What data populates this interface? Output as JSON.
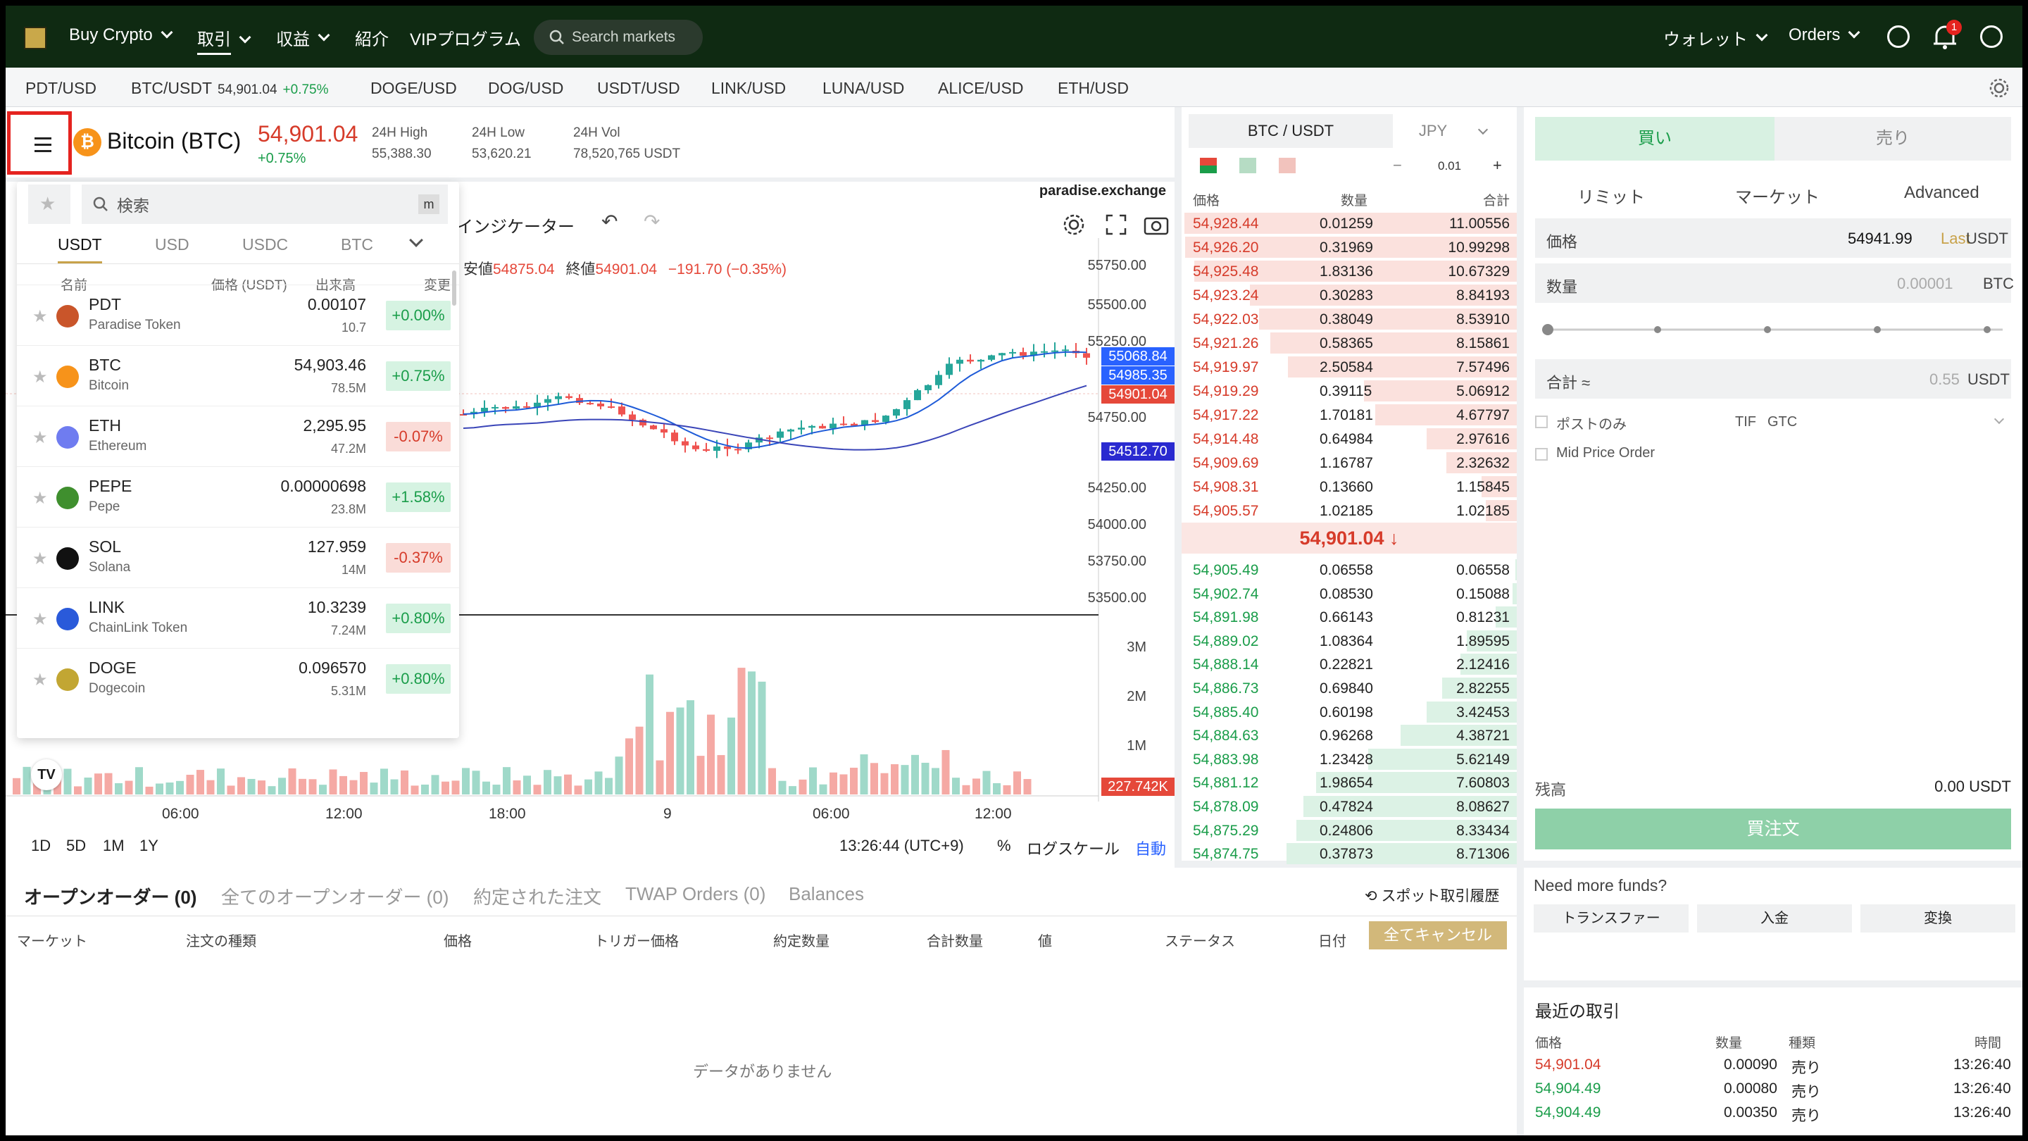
{
  "nav": {
    "items": [
      "Buy Crypto",
      "取引",
      "収益",
      "紹介",
      "VIPプログラム"
    ],
    "search_placeholder": "Search markets",
    "wallet": "ウォレット",
    "orders": "Orders",
    "notif_count": "1"
  },
  "tickers": [
    {
      "label": "PDT/USD"
    },
    {
      "label": "BTC/USDT",
      "price": "54,901.04",
      "change": "+0.75%"
    },
    {
      "label": "DOGE/USD"
    },
    {
      "label": "DOG/USD"
    },
    {
      "label": "USDT/USD"
    },
    {
      "label": "LINK/USD"
    },
    {
      "label": "LUNA/USD"
    },
    {
      "label": "ALICE/USD"
    },
    {
      "label": "ETH/USD"
    }
  ],
  "header": {
    "pair": "Bitcoin (BTC)",
    "price": "54,901.04",
    "change": "+0.75%",
    "high_label": "24H High",
    "high": "55,388.30",
    "low_label": "24H Low",
    "low": "53,620.21",
    "vol_label": "24H Vol",
    "vol": "78,520,765 USDT"
  },
  "chart": {
    "watermark": "paradise.exchange",
    "indicators": "インジケーター",
    "ohlc_low_label": "安値",
    "ohlc_low": "54875.04",
    "ohlc_close_label": "終値",
    "ohlc_close": "54901.04",
    "ohlc_change": "−191.70 (−0.35%)",
    "price_axis": [
      "55750.00",
      "55500.00",
      "55250.00",
      "54750.00",
      "54250.00",
      "54000.00",
      "53750.00",
      "53500.00"
    ],
    "price_tags": [
      {
        "value": "55068.84",
        "color": "#2962ff"
      },
      {
        "value": "54985.35",
        "color": "#2962ff"
      },
      {
        "value": "54901.04",
        "color": "#e5483a"
      },
      {
        "value": "54512.70",
        "color": "#2a2ad0"
      }
    ],
    "volume_axis": [
      "3M",
      "2M",
      "1M"
    ],
    "volume_tag": "227.742K",
    "time_axis": [
      "06:00",
      "12:00",
      "18:00",
      "9",
      "06:00",
      "12:00"
    ],
    "intervals": [
      "1D",
      "5D",
      "1M",
      "1Y"
    ],
    "clock": "13:26:44 (UTC+9)",
    "percent": "%",
    "log": "ログスケール",
    "auto": "自動"
  },
  "dropdown": {
    "search_placeholder": "検索",
    "shortcut": "m",
    "tabs": [
      "USDT",
      "USD",
      "USDC",
      "BTC"
    ],
    "cols": {
      "name": "名前",
      "price": "価格 (USDT)",
      "vol": "出来高",
      "change": "変更"
    },
    "rows": [
      {
        "sym": "PDT",
        "name": "Paradise Token",
        "price": "0.00107",
        "vol": "10.7",
        "change": "+0.00%",
        "dir": "up",
        "color": "#c9552a"
      },
      {
        "sym": "BTC",
        "name": "Bitcoin",
        "price": "54,903.46",
        "vol": "78.5M",
        "change": "+0.75%",
        "dir": "up",
        "color": "#f7931a"
      },
      {
        "sym": "ETH",
        "name": "Ethereum",
        "price": "2,295.95",
        "vol": "47.2M",
        "change": "-0.07%",
        "dir": "dn",
        "color": "#6f7cf0"
      },
      {
        "sym": "PEPE",
        "name": "Pepe",
        "price": "0.00000698",
        "vol": "23.8M",
        "change": "+1.58%",
        "dir": "up",
        "color": "#3f8f2e"
      },
      {
        "sym": "SOL",
        "name": "Solana",
        "price": "127.959",
        "vol": "14M",
        "change": "-0.37%",
        "dir": "dn",
        "color": "#111111"
      },
      {
        "sym": "LINK",
        "name": "ChainLink Token",
        "price": "10.3239",
        "vol": "7.24M",
        "change": "+0.80%",
        "dir": "up",
        "color": "#2a5ada"
      },
      {
        "sym": "DOGE",
        "name": "Dogecoin",
        "price": "0.096570",
        "vol": "5.31M",
        "change": "+0.80%",
        "dir": "up",
        "color": "#c2a633"
      }
    ]
  },
  "orderbook": {
    "tab_pair": "BTC / USDT",
    "tab_quote": "JPY",
    "tick": "0.01",
    "cols": [
      "価格",
      "数量",
      "合計"
    ],
    "asks": [
      [
        "54,928.44",
        "0.01259",
        "11.00556"
      ],
      [
        "54,926.20",
        "0.31969",
        "10.99298"
      ],
      [
        "54,925.48",
        "1.83136",
        "10.67329"
      ],
      [
        "54,923.24",
        "0.30283",
        "8.84193"
      ],
      [
        "54,922.03",
        "0.38049",
        "8.53910"
      ],
      [
        "54,921.26",
        "0.58365",
        "8.15861"
      ],
      [
        "54,919.97",
        "2.50584",
        "7.57496"
      ],
      [
        "54,919.29",
        "0.39115",
        "5.06912"
      ],
      [
        "54,917.22",
        "1.70181",
        "4.67797"
      ],
      [
        "54,914.48",
        "0.64984",
        "2.97616"
      ],
      [
        "54,909.69",
        "1.16787",
        "2.32632"
      ],
      [
        "54,908.31",
        "0.13660",
        "1.15845"
      ],
      [
        "54,905.57",
        "1.02185",
        "1.02185"
      ]
    ],
    "mid": "54,901.04 ↓",
    "bids": [
      [
        "54,905.49",
        "0.06558",
        "0.06558"
      ],
      [
        "54,902.74",
        "0.08530",
        "0.15088"
      ],
      [
        "54,891.98",
        "0.66143",
        "0.81231"
      ],
      [
        "54,889.02",
        "1.08364",
        "1.89595"
      ],
      [
        "54,888.14",
        "0.22821",
        "2.12416"
      ],
      [
        "54,886.73",
        "0.69840",
        "2.82255"
      ],
      [
        "54,885.40",
        "0.60198",
        "3.42453"
      ],
      [
        "54,884.63",
        "0.96268",
        "4.38721"
      ],
      [
        "54,883.98",
        "1.23428",
        "5.62149"
      ],
      [
        "54,881.12",
        "1.98654",
        "7.60803"
      ],
      [
        "54,878.09",
        "0.47824",
        "8.08627"
      ],
      [
        "54,875.29",
        "0.24806",
        "8.33434"
      ],
      [
        "54,874.75",
        "0.37873",
        "8.71306"
      ]
    ]
  },
  "order_form": {
    "buy": "買い",
    "sell": "売り",
    "types": [
      "リミット",
      "マーケット",
      "Advanced"
    ],
    "price_label": "価格",
    "price_value": "54941.99",
    "price_last": "Last",
    "price_unit": "USDT",
    "qty_label": "数量",
    "qty_placeholder": "0.00001",
    "qty_unit": "BTC",
    "total_label": "合計 ≈",
    "total_placeholder": "0.55",
    "total_unit": "USDT",
    "post_only": "ポストのみ",
    "tif": "TIF",
    "tif_value": "GTC",
    "mid_price": "Mid Price Order",
    "balance_label": "残高",
    "balance": "0.00 USDT",
    "submit": "買注文"
  },
  "orders_panel": {
    "tabs": [
      "オープンオーダー (0)",
      "全てのオープンオーダー (0)",
      "約定された注文",
      "TWAP Orders (0)",
      "Balances"
    ],
    "history": "スポット取引履歴",
    "cols": [
      "マーケット",
      "注文の種類",
      "価格",
      "トリガー価格",
      "約定数量",
      "合計数量",
      "値",
      "ステータス",
      "日付"
    ],
    "cancel_all": "全てキャンセル",
    "empty": "データがありません"
  },
  "funds": {
    "title": "Need more funds?",
    "buttons": [
      "トランスファー",
      "入金",
      "変換"
    ]
  },
  "trades": {
    "title": "最近の取引",
    "cols": [
      "価格",
      "数量",
      "種類",
      "時間"
    ],
    "rows": [
      {
        "price": "54,901.04",
        "qty": "0.00090",
        "side": "売り",
        "time": "13:26:40",
        "color": "#d63b2a"
      },
      {
        "price": "54,904.49",
        "qty": "0.00080",
        "side": "売り",
        "time": "13:26:40",
        "color": "#1a9d4a"
      },
      {
        "price": "54,904.49",
        "qty": "0.00350",
        "side": "売り",
        "time": "13:26:40",
        "color": "#1a9d4a"
      }
    ]
  },
  "colors": {
    "up": "#1a9d4a",
    "down": "#d63b2a",
    "accent": "#c8a24a",
    "nav_bg": "#0f2a12"
  }
}
